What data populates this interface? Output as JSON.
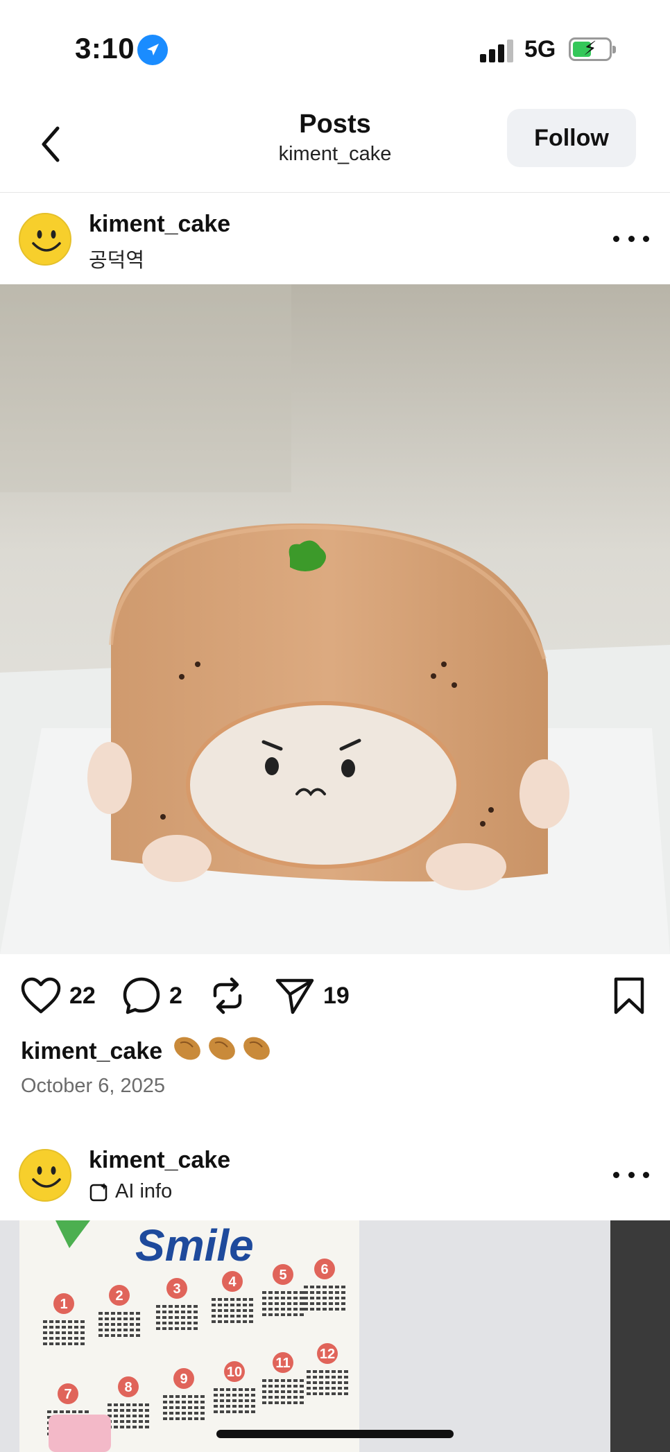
{
  "status_bar": {
    "time": "3:10",
    "network": "5G",
    "location_icon": "location-arrow-icon",
    "battery_charging": true,
    "battery_level_percent": 45
  },
  "header": {
    "title": "Posts",
    "subtitle": "kiment_cake",
    "follow_label": "Follow",
    "back_icon": "chevron-left-icon"
  },
  "posts": [
    {
      "username": "kiment_cake",
      "location": "공덕역",
      "likes": "22",
      "comments": "2",
      "shares": "19",
      "caption_user": "kiment_cake",
      "date": "October 6, 2025",
      "image": "Bread-shaped cake with cute white face"
    },
    {
      "username": "kiment_cake",
      "ai_info": "AI info",
      "calendar_heading": "Smile",
      "calendar_months": [
        "1",
        "2",
        "3",
        "4",
        "5",
        "6",
        "7",
        "8",
        "9",
        "10",
        "11",
        "12"
      ]
    }
  ],
  "colors": {
    "avatar_yellow": "#f7cf2c",
    "follow_bg": "#eff1f4",
    "cake_tan": "#d8a57a",
    "location_blue": "#1a8cff",
    "battery_green": "#34c759"
  }
}
